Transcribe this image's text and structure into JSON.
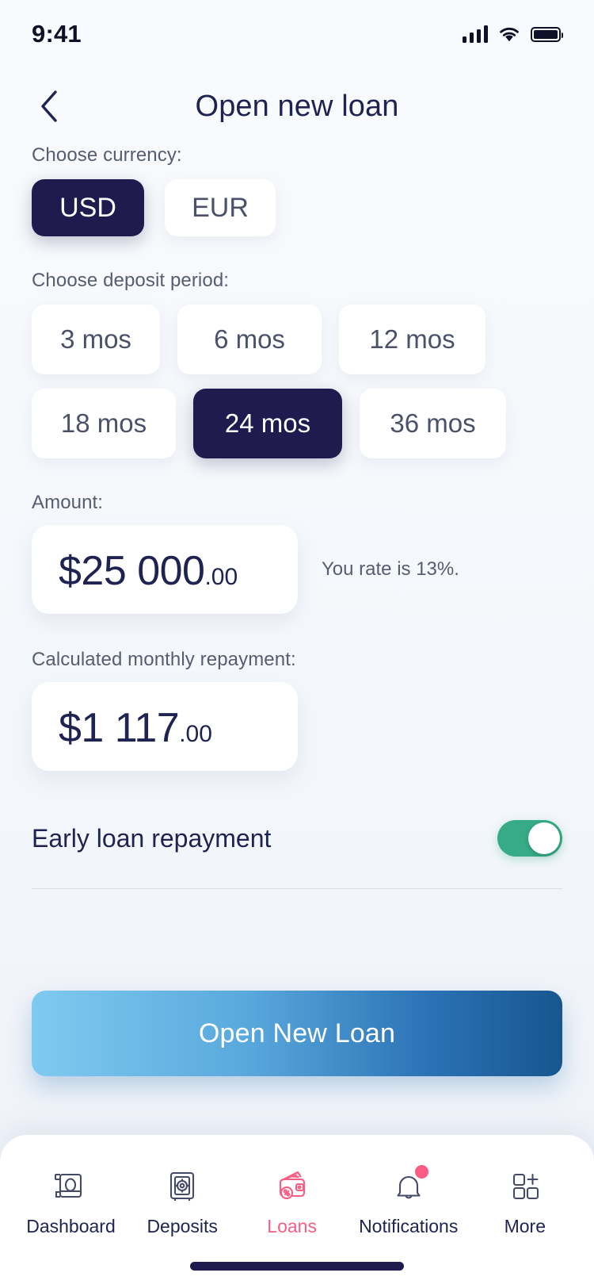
{
  "status_bar": {
    "time": "9:41",
    "signal_icon": "cellular-signal-icon",
    "wifi_icon": "wifi-icon",
    "battery_icon": "battery-full-icon"
  },
  "header": {
    "back_icon": "chevron-left-icon",
    "title": "Open new loan"
  },
  "currency": {
    "label": "Choose currency:",
    "options": [
      {
        "label": "USD",
        "selected": true
      },
      {
        "label": "EUR",
        "selected": false
      }
    ]
  },
  "deposit_period": {
    "label": "Choose deposit period:",
    "options": [
      {
        "label": "3 mos",
        "selected": false
      },
      {
        "label": "6 mos",
        "selected": false
      },
      {
        "label": "12 mos",
        "selected": false
      },
      {
        "label": "18 mos",
        "selected": false
      },
      {
        "label": "24 mos",
        "selected": true
      },
      {
        "label": "36 mos",
        "selected": false
      }
    ]
  },
  "amount": {
    "label": "Amount:",
    "value_main": "$25 000",
    "value_cents": ".00",
    "rate_note": "You rate is 13%."
  },
  "repayment": {
    "label": "Calculated monthly repayment:",
    "value_main": "$1 117",
    "value_cents": ".00"
  },
  "early_repayment": {
    "label": "Early loan repayment",
    "enabled": true
  },
  "cta": {
    "label": "Open New Loan"
  },
  "tabbar": {
    "items": [
      {
        "label": "Dashboard",
        "icon": "money-bill-icon",
        "active": false,
        "badge": false
      },
      {
        "label": "Deposits",
        "icon": "safe-vault-icon",
        "active": false,
        "badge": false
      },
      {
        "label": "Loans",
        "icon": "wallet-percent-icon",
        "active": true,
        "badge": false
      },
      {
        "label": "Notifications",
        "icon": "bell-icon",
        "active": false,
        "badge": true
      },
      {
        "label": "More",
        "icon": "grid-plus-icon",
        "active": false,
        "badge": false
      }
    ]
  },
  "colors": {
    "navy": "#201b4e",
    "accent_pink": "#fb5c84",
    "toggle_green": "#36ab85",
    "cta_gradient_from": "#7fcaf0",
    "cta_gradient_to": "#17568f",
    "background": "#f7f9fc"
  }
}
